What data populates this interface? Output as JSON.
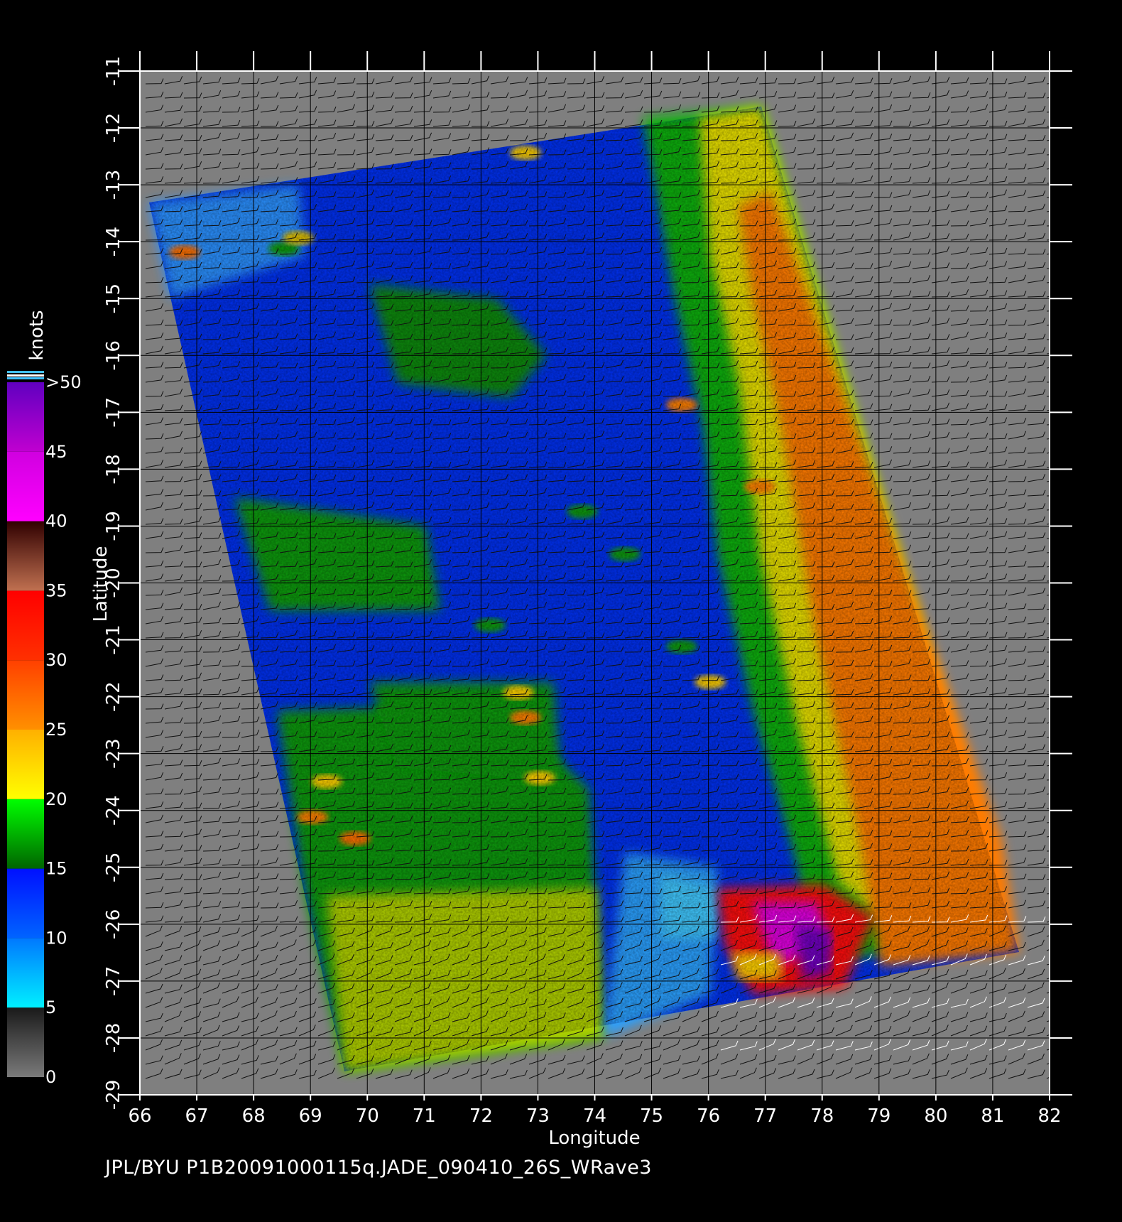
{
  "map": {
    "x_axis_label": "Longitude",
    "y_axis_label": "Latitude",
    "longitude_ticks": [
      "66",
      "67",
      "68",
      "69",
      "70",
      "71",
      "72",
      "73",
      "74",
      "75",
      "76",
      "77",
      "78",
      "79",
      "80",
      "81",
      "82"
    ],
    "latitude_ticks": [
      "-11",
      "-12",
      "-13",
      "-14",
      "-15",
      "-16",
      "-17",
      "-18",
      "-19",
      "-20",
      "-21",
      "-22",
      "-23",
      "-24",
      "-25",
      "-26",
      "-27",
      "-28",
      "-29"
    ],
    "lon_range": [
      66,
      82
    ],
    "lat_range": [
      -29,
      -11
    ],
    "background_color": "#7f7f7f",
    "grid": true,
    "wind_barbs": true
  },
  "colorbar": {
    "unit_label": "knots",
    "tick_labels": [
      ">50",
      "45",
      "40",
      "35",
      "30",
      "25",
      "20",
      "15",
      "10",
      "5",
      "0"
    ],
    "bands": [
      {
        "from": 0,
        "to": 5,
        "colors": [
          "#7a7a7a",
          "#1a1a1a"
        ]
      },
      {
        "from": 5,
        "to": 10,
        "colors": [
          "#00f0ff",
          "#0078ff"
        ]
      },
      {
        "from": 10,
        "to": 15,
        "colors": [
          "#0064ff",
          "#0010ff"
        ]
      },
      {
        "from": 15,
        "to": 20,
        "colors": [
          "#006400",
          "#00ff00"
        ]
      },
      {
        "from": 20,
        "to": 25,
        "colors": [
          "#ffff00",
          "#ffb000"
        ]
      },
      {
        "from": 25,
        "to": 30,
        "colors": [
          "#ff9000",
          "#ff4000"
        ]
      },
      {
        "from": 30,
        "to": 35,
        "colors": [
          "#ff3000",
          "#ff0000"
        ]
      },
      {
        "from": 35,
        "to": 40,
        "colors": [
          "#c07050",
          "#300000"
        ]
      },
      {
        "from": 40,
        "to": 45,
        "colors": [
          "#ff00ff",
          "#d000e0"
        ]
      },
      {
        "from": 45,
        "to": 50,
        "colors": [
          "#c000d0",
          "#6000c0"
        ]
      }
    ]
  },
  "footer": {
    "text": "JPL/BYU  P1B20091000115q.JADE_090410_26S_WRave3"
  }
}
